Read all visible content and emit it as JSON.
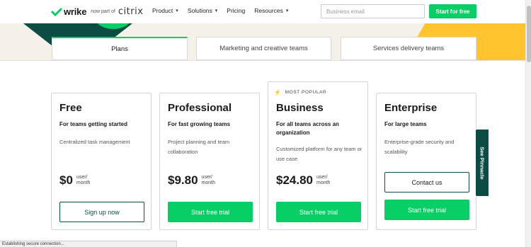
{
  "header": {
    "brand": "wrike",
    "part_of": "now part of",
    "partner": "citrix",
    "nav": [
      {
        "label": "Product",
        "has_menu": true
      },
      {
        "label": "Solutions",
        "has_menu": true
      },
      {
        "label": "Pricing",
        "has_menu": false
      },
      {
        "label": "Resources",
        "has_menu": true
      }
    ],
    "email_placeholder": "Business email",
    "cta": "Start for free"
  },
  "tabs": [
    {
      "label": "Plans",
      "active": true
    },
    {
      "label": "Marketing and creative teams",
      "active": false
    },
    {
      "label": "Services delivery teams",
      "active": false
    }
  ],
  "plans": [
    {
      "name": "Free",
      "subtitle": "For teams getting started",
      "description": "Centralized task management",
      "price": "$0",
      "unit_line1": "user/",
      "unit_line2": "month",
      "button": "Sign up now"
    },
    {
      "name": "Professional",
      "subtitle": "For fast growing teams",
      "description": "Project planning and team collaboration",
      "price": "$9.80",
      "unit_line1": "user/",
      "unit_line2": "month",
      "button": "Start free trial"
    },
    {
      "name": "Business",
      "badge": "MOST POPULAR",
      "subtitle": "For all teams across an organization",
      "description": "Customized platform for any team or use case",
      "price": "$24.80",
      "unit_line1": "user/",
      "unit_line2": "month",
      "button": "Start free trial"
    },
    {
      "name": "Enterprise",
      "subtitle": "For large teams",
      "description": "Enterprise-grade security and scalability",
      "contact": "Contact us",
      "button": "Start free trial"
    }
  ],
  "side_tab": "See Pinnacle",
  "status_bar": "Establishing secure connection...",
  "colors": {
    "brand_green": "#08cf65",
    "dark_teal": "#0b4d45",
    "accent_yellow": "#ffc42e"
  }
}
